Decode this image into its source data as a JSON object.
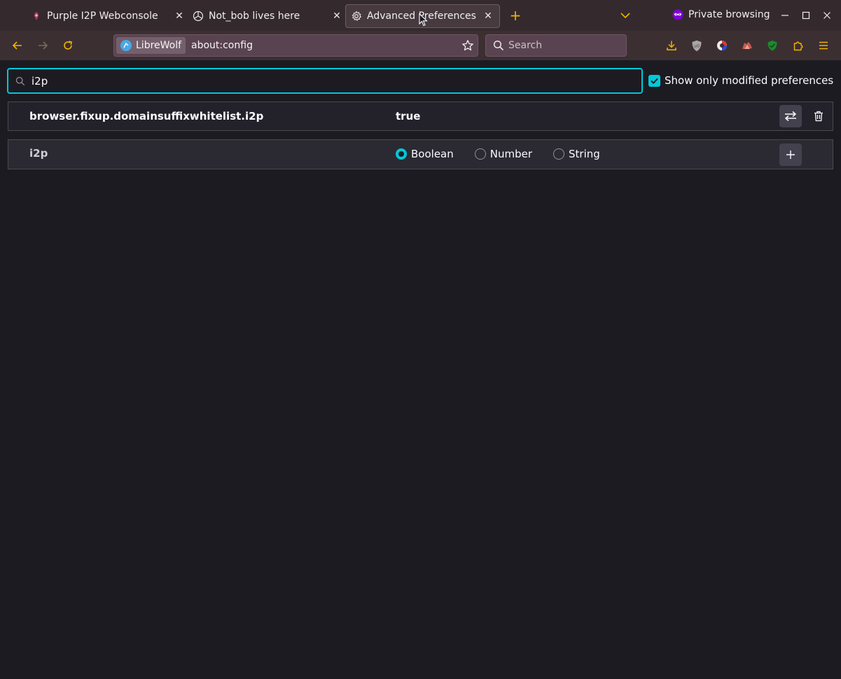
{
  "tabs": [
    {
      "title": "Purple I2P Webconsole",
      "icon": "i2p-icon",
      "selected": false
    },
    {
      "title": "Not_bob lives here",
      "icon": "mercedes-icon",
      "selected": false
    },
    {
      "title": "Advanced Preferences",
      "icon": "gear-icon",
      "selected": true
    }
  ],
  "tabbar": {
    "private_label": "Private browsing"
  },
  "urlbar": {
    "identity_label": "LibreWolf",
    "url": "about:config"
  },
  "searchbar": {
    "placeholder": "Search"
  },
  "config": {
    "filter_value": "i2p",
    "show_modified_label": "Show only modified preferences",
    "show_modified_checked": true,
    "prefs": [
      {
        "name": "browser.fixup.domainsuffixwhitelist.i2p",
        "value": "true"
      }
    ],
    "new_pref": {
      "name": "i2p",
      "types": [
        "Boolean",
        "Number",
        "String"
      ],
      "selected_type": "Boolean"
    }
  },
  "colors": {
    "accent": "#00c8d7",
    "tabstrip": "#342a2d",
    "navbar": "#3c2f32",
    "content_bg": "#1c1b22"
  }
}
